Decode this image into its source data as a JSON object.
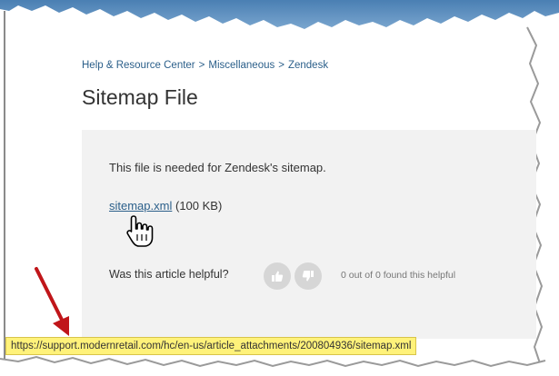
{
  "breadcrumb": {
    "items": [
      "Help & Resource Center",
      "Miscellaneous",
      "Zendesk"
    ],
    "separator": ">"
  },
  "article": {
    "title": "Sitemap File",
    "body": "This file is needed for Zendesk's sitemap.",
    "attachment": {
      "filename": "sitemap.xml",
      "size": "(100 KB)"
    }
  },
  "feedback": {
    "question": "Was this article helpful?",
    "upvote_icon": "thumbs-up-icon",
    "downvote_icon": "thumbs-down-icon",
    "count_text": "0 out of 0 found this helpful"
  },
  "status_bar": {
    "url": "https://support.modernretail.com/hc/en-us/article_attachments/200804936/sitemap.xml"
  },
  "colors": {
    "link": "#2b5f8a",
    "title": "#333333",
    "article_bg": "#f2f2f2",
    "vote_btn": "#d6d6d6",
    "status_highlight": "#fff27a",
    "annotation_arrow": "#c0161a",
    "torn_edge": "#5b8fc0"
  }
}
